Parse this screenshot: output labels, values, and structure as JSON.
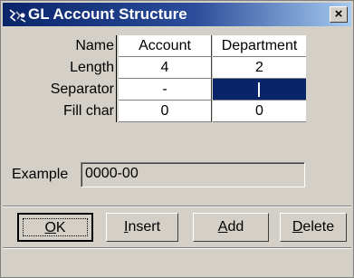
{
  "window": {
    "title": "GL Account Structure",
    "close_label": "×",
    "icon": "gl-structure-icon"
  },
  "grid": {
    "rows": [
      {
        "label": "Name",
        "values": [
          "Account",
          "Department"
        ]
      },
      {
        "label": "Length",
        "values": [
          "4",
          "2"
        ]
      },
      {
        "label": "Separator",
        "values": [
          "-",
          ""
        ]
      },
      {
        "label": "Fill char",
        "values": [
          "0",
          "0"
        ]
      }
    ],
    "selected_cell": {
      "row": 2,
      "column": 1
    }
  },
  "example": {
    "label": "Example",
    "value": "0000-00"
  },
  "buttons": {
    "ok": {
      "accel": "O",
      "rest": "K"
    },
    "insert": {
      "accel": "I",
      "rest": "nsert"
    },
    "add": {
      "accel": "A",
      "rest": "dd"
    },
    "delete": {
      "accel": "D",
      "rest": "elete"
    }
  },
  "colors": {
    "titlebar_start": "#0a246a",
    "titlebar_end": "#a6caf0",
    "selection": "#0a246a",
    "face": "#d4d0c8"
  }
}
